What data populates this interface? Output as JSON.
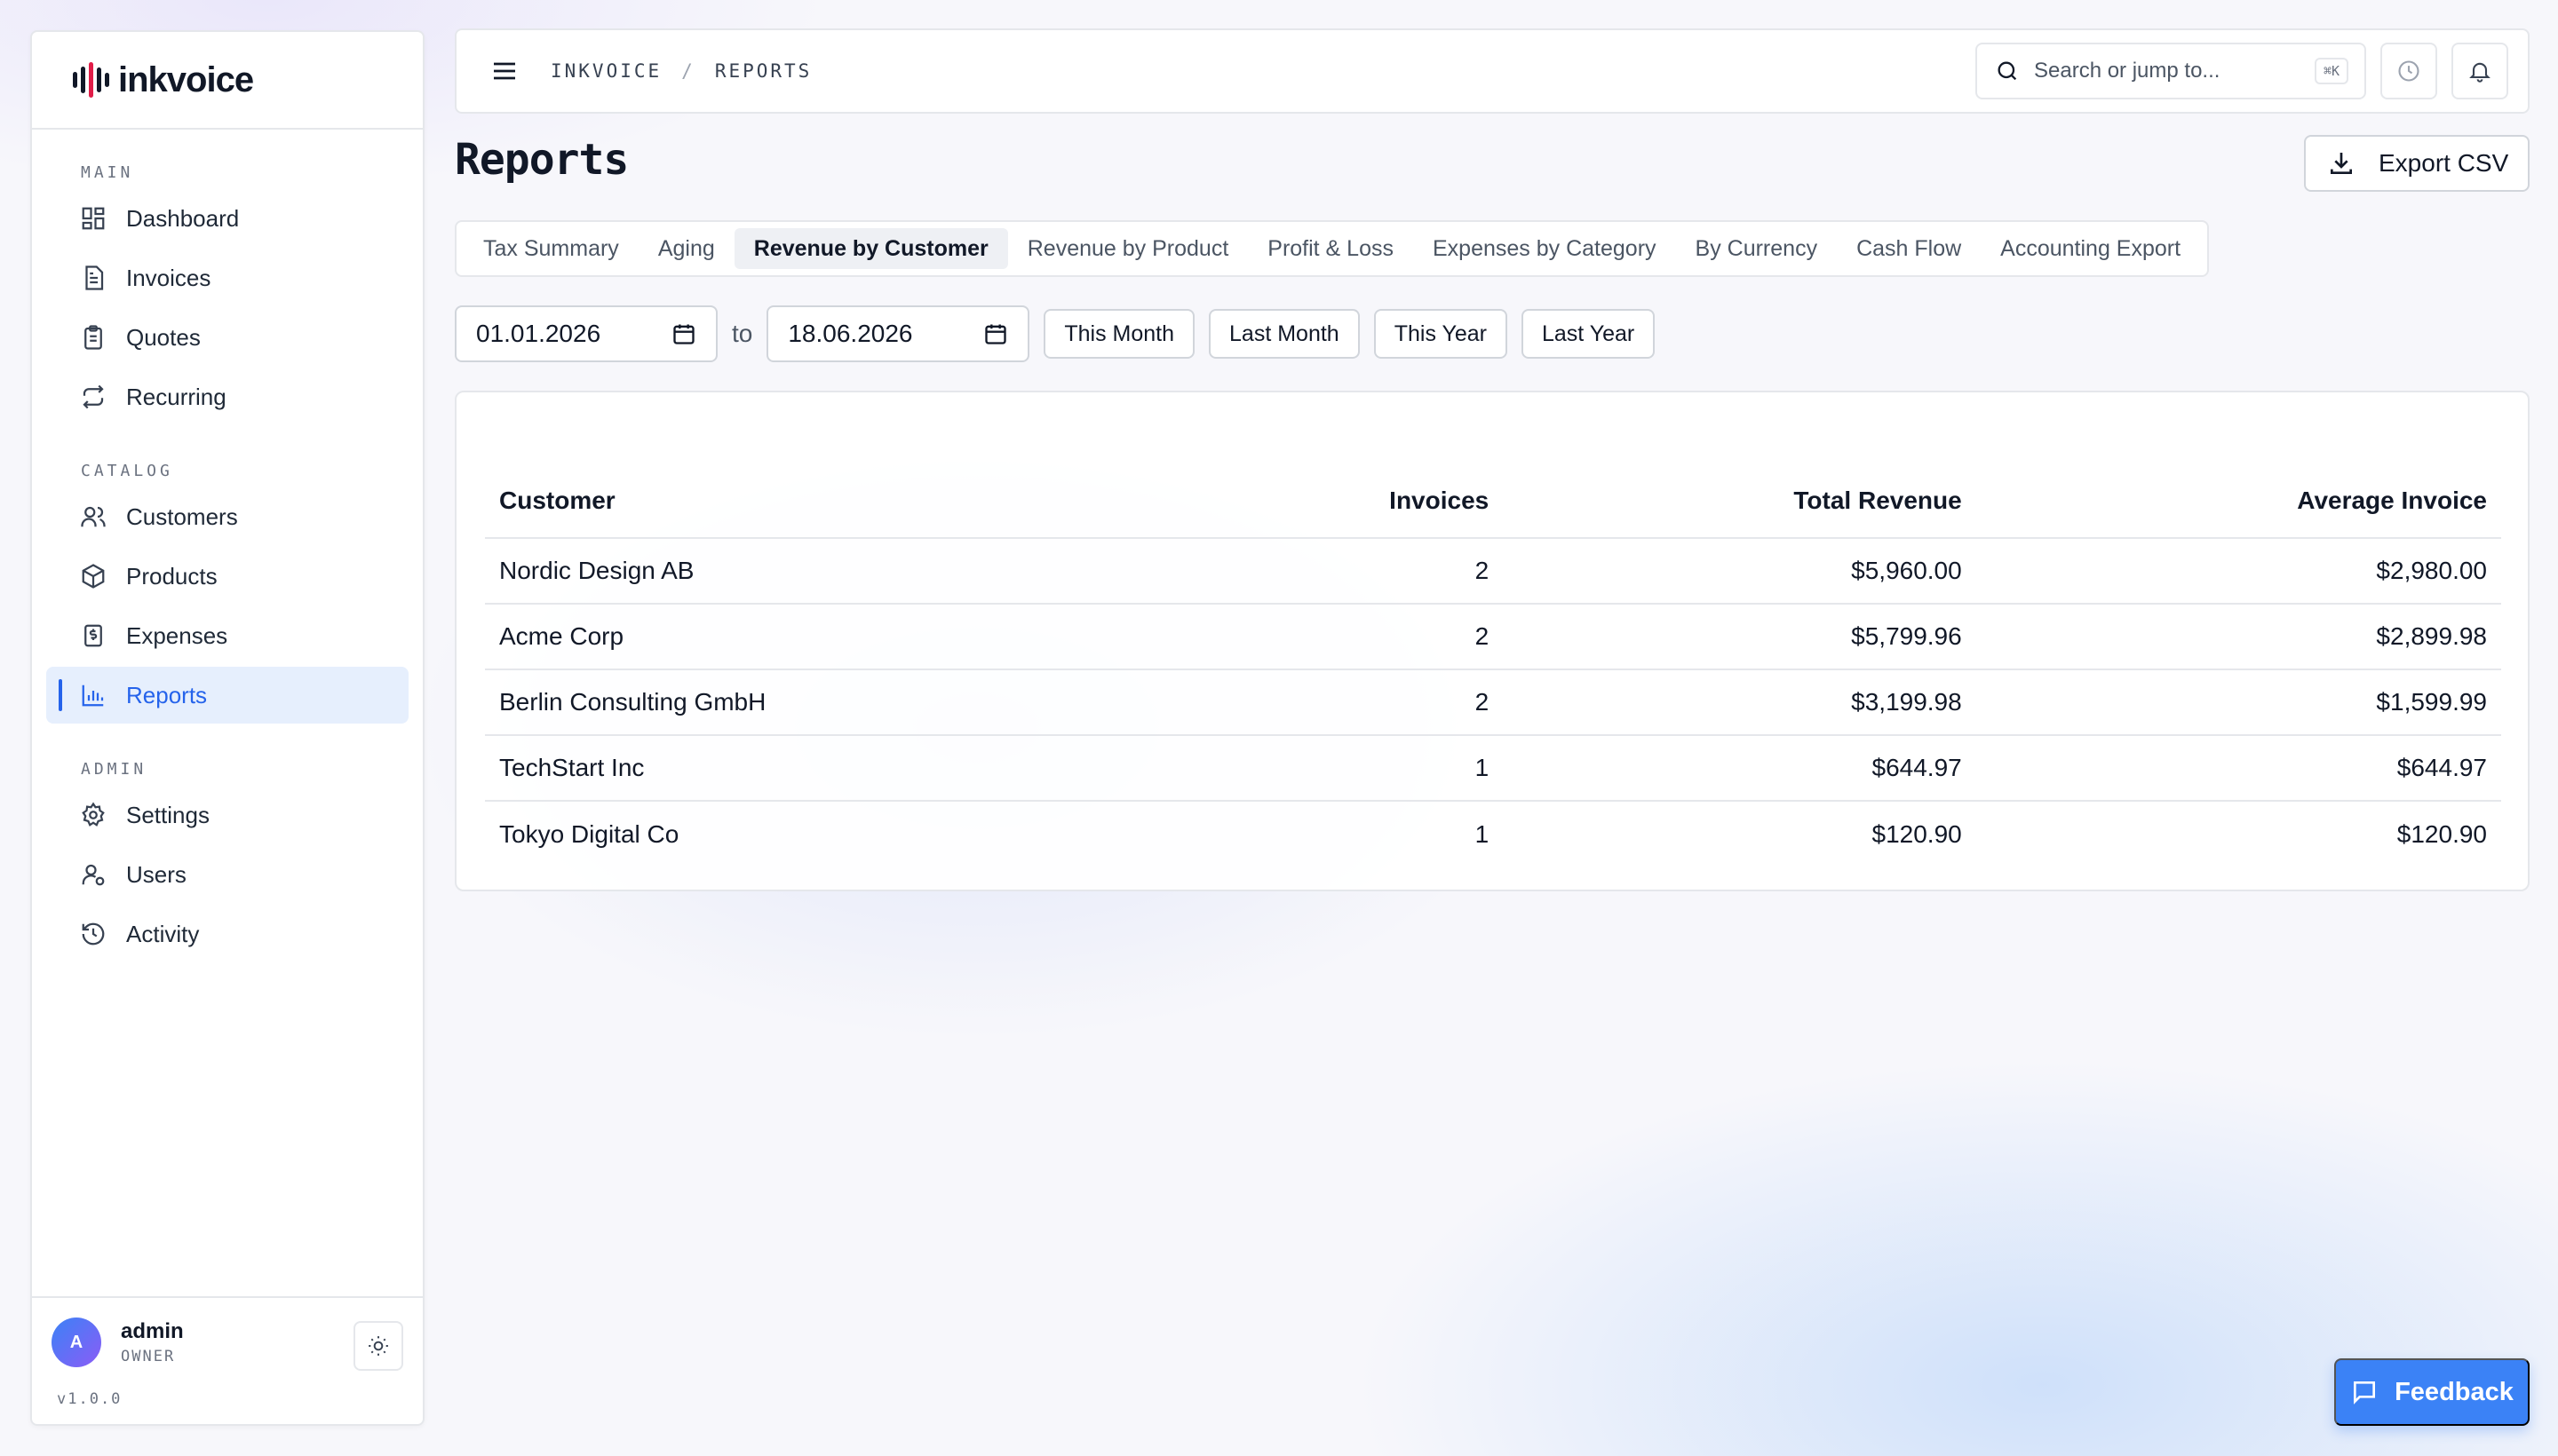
{
  "app": {
    "brand": "inkvoice",
    "version": "v1.0.0"
  },
  "sidebar": {
    "sections": [
      {
        "heading": "MAIN",
        "items": [
          {
            "label": "Dashboard",
            "icon": "dashboard-icon"
          },
          {
            "label": "Invoices",
            "icon": "invoice-icon"
          },
          {
            "label": "Quotes",
            "icon": "clipboard-icon"
          },
          {
            "label": "Recurring",
            "icon": "repeat-icon"
          }
        ]
      },
      {
        "heading": "CATALOG",
        "items": [
          {
            "label": "Customers",
            "icon": "users-icon"
          },
          {
            "label": "Products",
            "icon": "package-icon"
          },
          {
            "label": "Expenses",
            "icon": "receipt-icon"
          },
          {
            "label": "Reports",
            "icon": "bar-chart-icon",
            "active": true
          }
        ]
      },
      {
        "heading": "ADMIN",
        "items": [
          {
            "label": "Settings",
            "icon": "gear-icon"
          },
          {
            "label": "Users",
            "icon": "user-icon"
          },
          {
            "label": "Activity",
            "icon": "history-icon"
          }
        ]
      }
    ],
    "user": {
      "initial": "A",
      "name": "admin",
      "role": "OWNER"
    }
  },
  "topbar": {
    "breadcrumb": [
      "INKVOICE",
      "REPORTS"
    ],
    "breadcrumb_separator": "/",
    "search_placeholder": "Search or jump to...",
    "search_shortcut": "⌘K"
  },
  "page": {
    "title": "Reports",
    "export_label": "Export CSV"
  },
  "tabs": [
    {
      "label": "Tax Summary"
    },
    {
      "label": "Aging"
    },
    {
      "label": "Revenue by Customer",
      "active": true
    },
    {
      "label": "Revenue by Product"
    },
    {
      "label": "Profit & Loss"
    },
    {
      "label": "Expenses by Category"
    },
    {
      "label": "By Currency"
    },
    {
      "label": "Cash Flow"
    },
    {
      "label": "Accounting Export"
    }
  ],
  "filters": {
    "from": "01.01.2026",
    "to_label": "to",
    "to": "18.06.2026",
    "presets": [
      "This Month",
      "Last Month",
      "This Year",
      "Last Year"
    ]
  },
  "table": {
    "columns": [
      "Customer",
      "Invoices",
      "Total Revenue",
      "Average Invoice"
    ],
    "rows": [
      [
        "Nordic Design AB",
        "2",
        "$5,960.00",
        "$2,980.00"
      ],
      [
        "Acme Corp",
        "2",
        "$5,799.96",
        "$2,899.98"
      ],
      [
        "Berlin Consulting GmbH",
        "2",
        "$3,199.98",
        "$1,599.99"
      ],
      [
        "TechStart Inc",
        "1",
        "$644.97",
        "$644.97"
      ],
      [
        "Tokyo Digital Co",
        "1",
        "$120.90",
        "$120.90"
      ]
    ]
  },
  "feedback_label": "Feedback",
  "colors": {
    "accent": "#2563eb",
    "active_bg": "#e6effd",
    "feedback": "#3b82f6"
  }
}
